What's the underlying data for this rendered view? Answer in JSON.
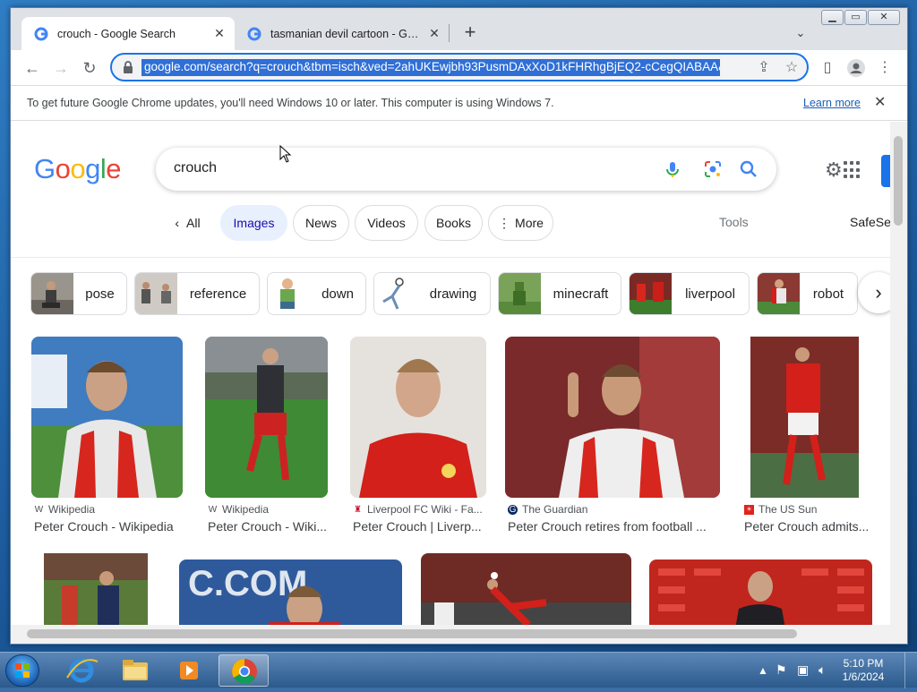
{
  "browser": {
    "tabs": [
      {
        "title": "crouch - Google Search",
        "active": true
      },
      {
        "title": "tasmanian devil cartoon - Google",
        "active": false
      }
    ],
    "new_tab": "+",
    "url": "google.com/search?q=crouch&tbm=isch&ved=2ahUKEwjbh93PusmDAxXoD1kFHRhgBjEQ2-cCegQIABAA&oq",
    "infobar": {
      "message": "To get future Google Chrome updates, you'll need Windows 10 or later. This computer is using Windows 7.",
      "link": "Learn more"
    }
  },
  "search": {
    "logo": "Google",
    "query": "crouch",
    "filters": {
      "all": "All",
      "images": "Images",
      "news": "News",
      "videos": "Videos",
      "books": "Books",
      "more": "More",
      "tools": "Tools",
      "safesearch": "SafeSe"
    },
    "related": [
      "pose",
      "reference",
      "down",
      "drawing",
      "minecraft",
      "liverpool",
      "robot"
    ],
    "results": [
      {
        "source": "Wikipedia",
        "title": "Peter Crouch - Wikipedia",
        "source_icon": "W"
      },
      {
        "source": "Wikipedia",
        "title": "Peter Crouch - Wiki...",
        "source_icon": "W"
      },
      {
        "source": "Liverpool FC Wiki - Fa...",
        "title": "Peter Crouch | Liverp...",
        "source_icon": "crest"
      },
      {
        "source": "The Guardian",
        "title": "Peter Crouch retires from football ...",
        "source_icon": "G"
      },
      {
        "source": "The US Sun",
        "title": "Peter Crouch admits...",
        "source_icon": "sun"
      }
    ]
  },
  "taskbar": {
    "time": "5:10 PM",
    "date": "1/6/2024"
  },
  "colors": {
    "accent": "#1a73e8",
    "google_blue": "#4285f4",
    "google_red": "#ea4335",
    "google_yellow": "#fbbc05",
    "google_green": "#34a853"
  }
}
